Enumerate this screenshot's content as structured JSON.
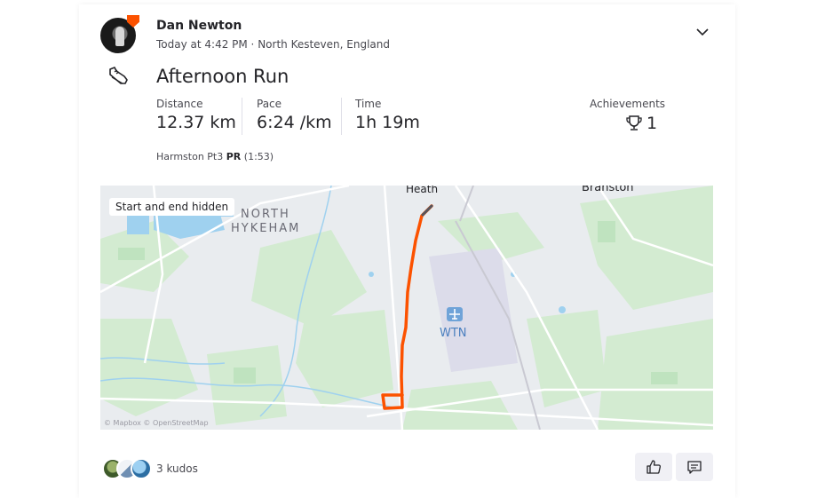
{
  "athlete": {
    "name": "Dan Newton",
    "meta": "Today at 4:42 PM · North Kesteven, England"
  },
  "activity": {
    "title": "Afternoon Run",
    "sport_icon": "running-shoe-icon",
    "stats": [
      {
        "label": "Distance",
        "value": "12.37 km"
      },
      {
        "label": "Pace",
        "value": "6:24 /km"
      },
      {
        "label": "Time",
        "value": "1h 19m"
      }
    ],
    "achievements": {
      "label": "Achievements",
      "value": "1",
      "icon": "trophy-icon"
    },
    "segment": {
      "name": "Harmston Pt3",
      "pr": "PR",
      "time": "(1:53)"
    }
  },
  "map": {
    "hidden_label": "Start and end hidden",
    "places": {
      "heath": "Heath",
      "branston": "Branston",
      "north": "NORTH",
      "hykeham": "HYKEHAM",
      "airport": "WTN"
    },
    "attribution": "© Mapbox © OpenStreetMap",
    "route_color": "#fc5200"
  },
  "social": {
    "kudos": "3 kudos",
    "kudos_icon": "thumbs-up-icon",
    "comment_icon": "comment-icon"
  },
  "colors": {
    "brand": "#fc5200",
    "map_green": "#d4ecd2",
    "map_water": "#9fd1ef"
  }
}
